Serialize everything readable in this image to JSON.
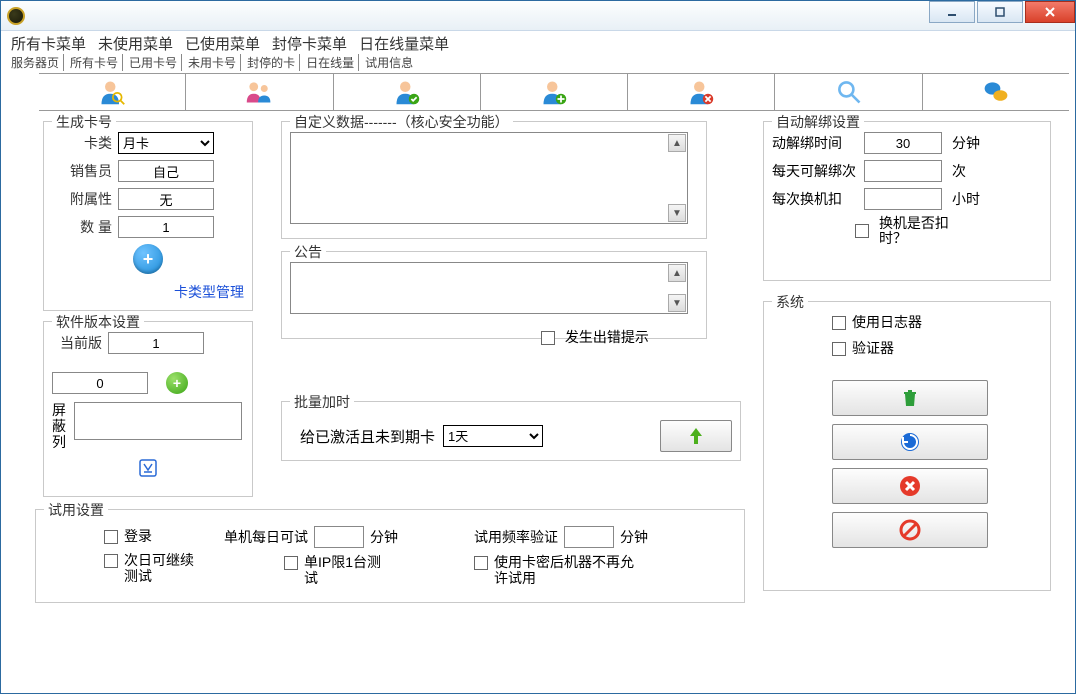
{
  "menubar": {
    "m1": "所有卡菜单",
    "m2": "未使用菜单",
    "m3": "已使用菜单",
    "m4": "封停卡菜单",
    "m5": "日在线量菜单"
  },
  "tabs": {
    "t1": "服务器页",
    "t2": "所有卡号",
    "t3": "已用卡号",
    "t4": "未用卡号",
    "t5": "封停的卡",
    "t6": "日在线量",
    "t7": "试用信息"
  },
  "gen": {
    "title": "生成卡号",
    "type_lbl": "卡类",
    "type_val": "月卡",
    "seller_lbl": "销售员",
    "seller_val": "自己",
    "attr_lbl": "附属性",
    "attr_val": "无",
    "qty_lbl": "数   量",
    "qty_val": "1",
    "manage_link": "卡类型管理"
  },
  "ver": {
    "title": "软件版本设置",
    "cur_lbl": "当前版",
    "cur_val": "1",
    "num_val": "0",
    "block_lbl": "屏蔽列"
  },
  "custom": {
    "title": "自定义数据-------（核心安全功能）"
  },
  "notice": {
    "title": "公告",
    "chk_lbl": "发生出错提示"
  },
  "batch": {
    "title": "批量加时",
    "lbl": "给已激活且未到期卡",
    "val": "1天"
  },
  "unbind": {
    "title": "自动解绑设置",
    "time_lbl": "动解绑时间",
    "time_val": "30",
    "time_unit": "分钟",
    "daily_lbl": "每天可解绑次",
    "daily_unit": "次",
    "swap_lbl": "每次换机扣",
    "swap_unit": "小时",
    "chk_lbl": "换机是否扣时？"
  },
  "system": {
    "title": "系统",
    "chk1": "使用日志器",
    "chk2": "验证器"
  },
  "trial": {
    "title": "试用设置",
    "chk1": "登录",
    "chk2": "次日可继续测试",
    "single_lbl": "单机每日可试",
    "single_unit": "分钟",
    "chk3": "单IP限1台测试",
    "freq_lbl": "试用频率验证",
    "freq_unit": "分钟",
    "chk4": "使用卡密后机器不再允许试用"
  }
}
